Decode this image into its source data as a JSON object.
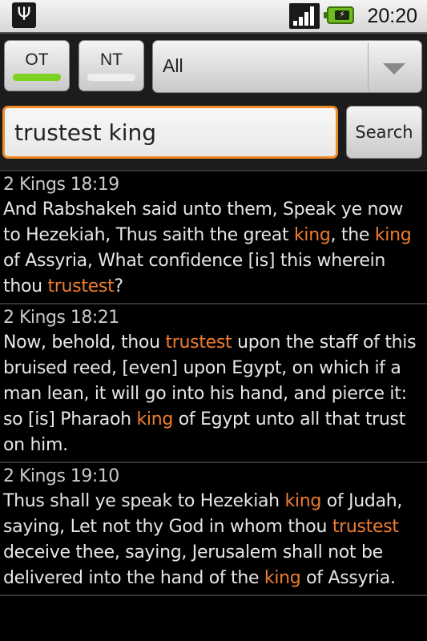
{
  "status_bar": {
    "usb_icon": "usb-icon",
    "signal_icon": "signal-strength-icon",
    "battery_icon": "battery-charging-icon",
    "time": "20:20"
  },
  "toolbar": {
    "ot_label": "OT",
    "ot_selected": true,
    "nt_label": "NT",
    "nt_selected": false,
    "book_select_value": "All",
    "accent_on": "#7ed321",
    "accent_off": "#eeeeee"
  },
  "search": {
    "query": "trustest king",
    "button_label": "Search",
    "highlight_color": "#ef7c2e"
  },
  "results": [
    {
      "reference": "2 Kings 18:19",
      "segments": [
        {
          "t": "And Rabshakeh said unto them, Speak ye now to Hezekiah, Thus saith the great ",
          "h": false
        },
        {
          "t": "king",
          "h": true
        },
        {
          "t": ", the ",
          "h": false
        },
        {
          "t": "king",
          "h": true
        },
        {
          "t": " of Assyria, What confidence [is] this wherein thou ",
          "h": false
        },
        {
          "t": "trustest",
          "h": true
        },
        {
          "t": "?",
          "h": false
        }
      ]
    },
    {
      "reference": "2 Kings 18:21",
      "segments": [
        {
          "t": "Now, behold, thou ",
          "h": false
        },
        {
          "t": "trustest",
          "h": true
        },
        {
          "t": " upon the staff of this bruised reed, [even] upon Egypt, on which if a man lean, it will go into his hand, and pierce it: so [is] Pharaoh ",
          "h": false
        },
        {
          "t": "king",
          "h": true
        },
        {
          "t": " of Egypt unto all that trust on him.",
          "h": false
        }
      ]
    },
    {
      "reference": "2 Kings 19:10",
      "segments": [
        {
          "t": "Thus shall ye speak to Hezekiah ",
          "h": false
        },
        {
          "t": "king",
          "h": true
        },
        {
          "t": " of Judah, saying, Let not thy God in whom thou ",
          "h": false
        },
        {
          "t": "trustest",
          "h": true
        },
        {
          "t": " deceive thee, saying, Jerusalem shall not be delivered into the hand of the ",
          "h": false
        },
        {
          "t": "king",
          "h": true
        },
        {
          "t": " of Assyria.",
          "h": false
        }
      ]
    }
  ]
}
